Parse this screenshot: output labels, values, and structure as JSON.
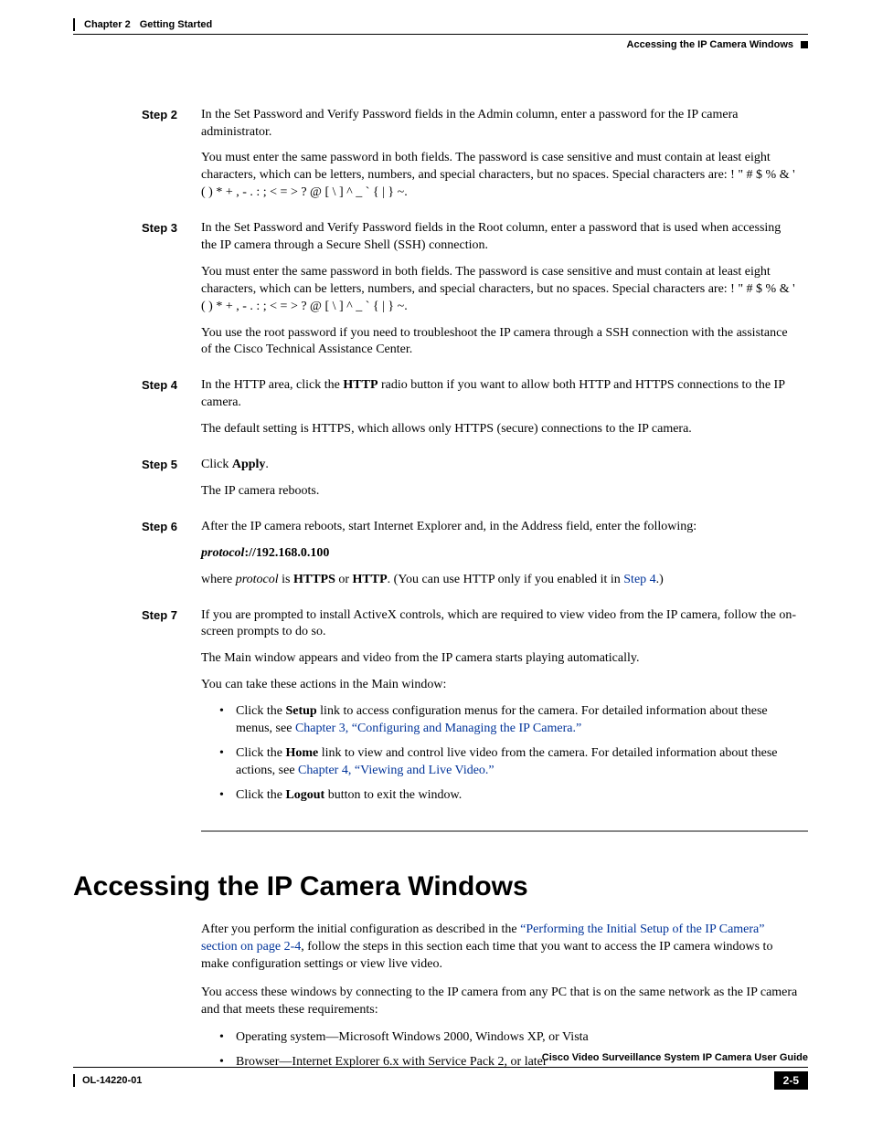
{
  "header": {
    "chapter_num": "Chapter 2",
    "chapter_title": "Getting Started",
    "section_title": "Accessing the IP Camera Windows"
  },
  "steps": {
    "s2": {
      "label": "Step 2",
      "p1": "In the Set Password and Verify Password fields in the Admin column, enter a password for the IP camera administrator.",
      "p2": "You must enter the same password in both fields. The password is case sensitive and must contain at least eight characters, which can be letters, numbers, and special characters, but no spaces. Special characters are: ! \" # $ % & ' ( ) * + , - . : ; < = > ? @ [ \\ ] ^ _ ` { | } ~."
    },
    "s3": {
      "label": "Step 3",
      "p1": "In the Set Password and Verify Password fields in the Root column, enter a password that is used when accessing the IP camera through a Secure Shell (SSH) connection.",
      "p2": "You must enter the same password in both fields. The password is case sensitive and must contain at least eight characters, which can be letters, numbers, and special characters, but no spaces. Special characters are: ! \" # $ % & ' ( ) * + , - . : ; < = > ? @ [ \\ ] ^ _ ` { | } ~.",
      "p3": "You use the root password if you need to troubleshoot the IP camera through a SSH connection with the assistance of the Cisco Technical Assistance Center."
    },
    "s4": {
      "label": "Step 4",
      "p1a": "In the HTTP area, click the ",
      "p1b": "HTTP",
      "p1c": " radio button if you want to allow both HTTP and HTTPS connections to the IP camera.",
      "p2": "The default setting is HTTPS, which allows only HTTPS (secure) connections to the IP camera."
    },
    "s5": {
      "label": "Step 5",
      "p1a": "Click ",
      "p1b": "Apply",
      "p1c": ".",
      "p2": "The IP camera reboots."
    },
    "s6": {
      "label": "Step 6",
      "p1": "After the IP camera reboots, start Internet Explorer and, in the Address field, enter the following:",
      "p2a": "protocol",
      "p2b": "://192.168.0.100",
      "p3a": "where ",
      "p3b": "protocol",
      "p3c": " is ",
      "p3d": "HTTPS",
      "p3e": " or ",
      "p3f": "HTTP",
      "p3g": ". (You can use HTTP only if you enabled it in ",
      "p3h": "Step 4",
      "p3i": ".)"
    },
    "s7": {
      "label": "Step 7",
      "p1": "If you are prompted to install ActiveX controls, which are required to view video from the IP camera, follow the on-screen prompts to do so.",
      "p2": "The Main window appears and video from the IP camera starts playing automatically.",
      "p3": "You can take these actions in the Main window:",
      "b1a": "Click the ",
      "b1b": "Setup",
      "b1c": " link to access configuration menus for the camera. For detailed information about these menus, see ",
      "b1d": "Chapter 3, “Configuring and Managing the IP Camera.”",
      "b2a": "Click the ",
      "b2b": "Home",
      "b2c": " link to view and control live video from the camera. For detailed information about these actions, see ",
      "b2d": "Chapter 4, “Viewing and Live Video.”",
      "b3a": "Click the ",
      "b3b": "Logout",
      "b3c": " button to exit the window."
    }
  },
  "section2": {
    "heading": "Accessing the IP Camera Windows",
    "p1a": "After you perform the initial configuration as described in the ",
    "p1b": "“Performing the Initial Setup of the IP Camera” section on page 2-4",
    "p1c": ", follow the steps in this section each time that you want to access the IP camera windows to make configuration settings or view live video.",
    "p2": "You access these windows by connecting to the IP camera from any PC that is on the same network as the IP camera and that meets these requirements:",
    "b1": "Operating system—Microsoft Windows 2000, Windows XP, or Vista",
    "b2": "Browser—Internet Explorer 6.x with Service Pack 2, or later"
  },
  "footer": {
    "doc_title": "Cisco Video Surveillance System IP Camera User Guide",
    "doc_num": "OL-14220-01",
    "page_num": "2-5"
  }
}
